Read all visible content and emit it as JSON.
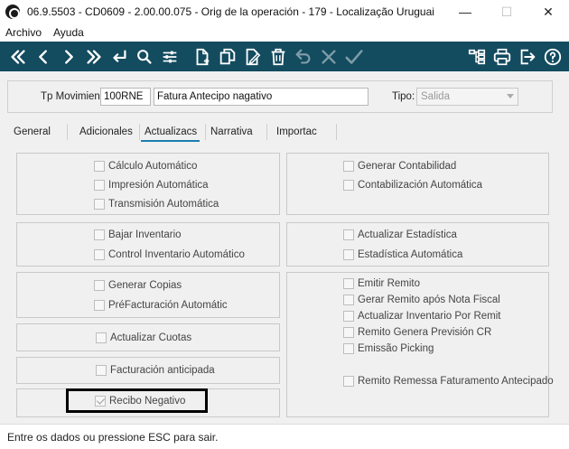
{
  "window": {
    "title": "06.9.5503 - CD0609 - 2.00.00.075 - Orig de la operación - 179 - Localização Uruguai",
    "minimize": "—",
    "maximize": "☐",
    "close": "✕"
  },
  "menu": [
    "Archivo",
    "Ayuda"
  ],
  "toolbar": {
    "icons": [
      "first-record",
      "previous-record",
      "next-record",
      "last-record",
      "return",
      "search",
      "filter-settings",
      "new-document",
      "copy",
      "edit",
      "delete",
      "undo",
      "cancel",
      "confirm",
      "tree",
      "print",
      "exit",
      "help"
    ]
  },
  "header": {
    "tp_label": "Tp Movimien:",
    "tp_code": "100RNE",
    "tp_desc": "Fatura Antecipo nagativo",
    "tipo_label": "Tipo:",
    "tipo_value": "Salida"
  },
  "tabs": [
    "General",
    "Adicionales",
    "Actualizacs",
    "Narrativa",
    "Importac"
  ],
  "active_tab": "Actualizacs",
  "left_groups": [
    [
      "Cálculo Automático",
      "Impresión Automática",
      "Transmisión Automática"
    ],
    [
      "Bajar Inventario",
      "Control Inventario Automático"
    ],
    [
      "Generar Copias",
      "PréFacturación Automátic"
    ],
    [
      "Actualizar Cuotas"
    ],
    [
      "Facturación anticipada"
    ],
    [
      "Recibo Negativo"
    ]
  ],
  "right_groups": [
    [
      "Generar Contabilidad",
      "Contabilización Automática"
    ],
    [
      "Actualizar Estadística",
      "Estadística Automática"
    ],
    [
      "Emitir Remito",
      "Gerar Remito após Nota Fiscal",
      "Actualizar Inventario Por Remit",
      "Remito Genera Previsión CR",
      "Emissão Picking",
      "Remito Remessa Faturamento Antecipado"
    ]
  ],
  "recibo_checked": true,
  "status": "Entre os dados ou pressione ESC para sair."
}
